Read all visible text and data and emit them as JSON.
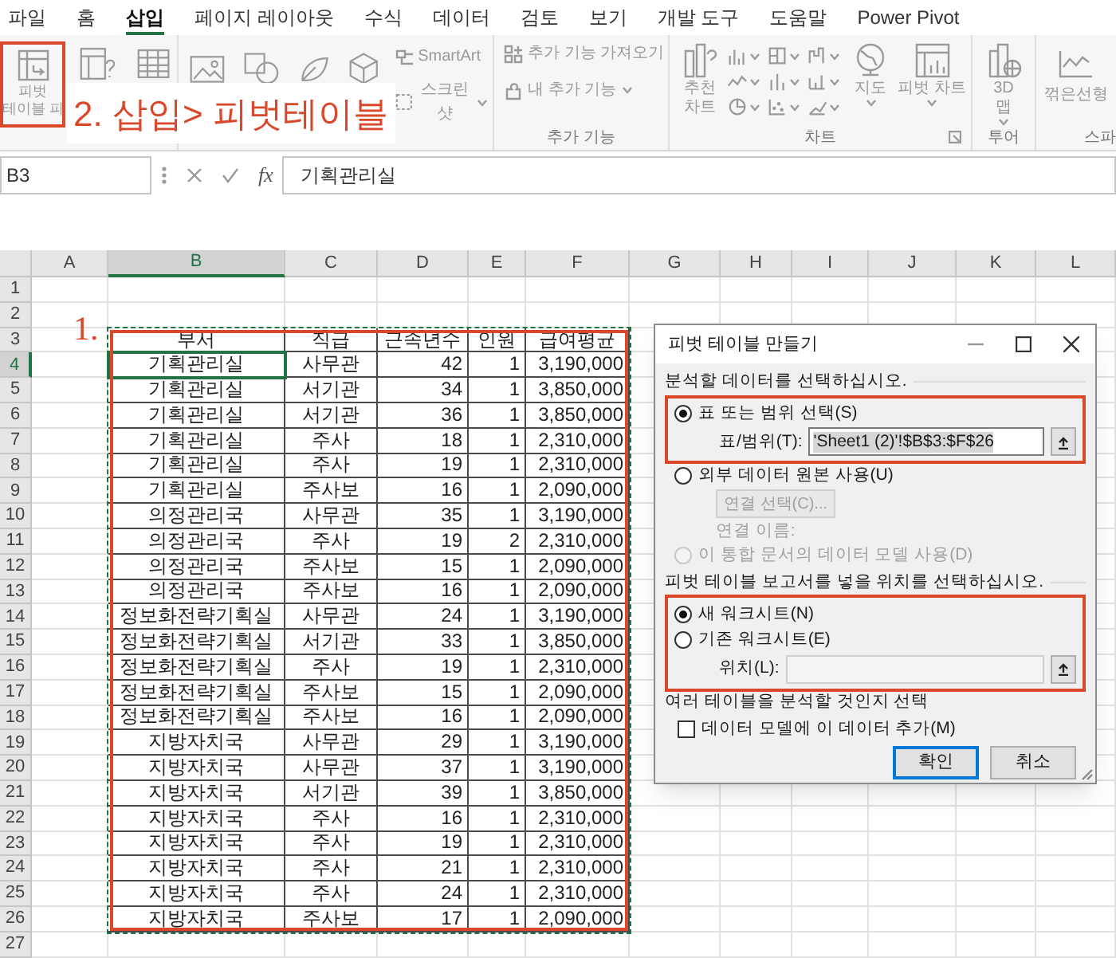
{
  "tabs": [
    {
      "label": "파일",
      "selected": false
    },
    {
      "label": "홈",
      "selected": false
    },
    {
      "label": "삽입",
      "selected": true
    },
    {
      "label": "페이지 레이아웃",
      "selected": false
    },
    {
      "label": "수식",
      "selected": false
    },
    {
      "label": "데이터",
      "selected": false
    },
    {
      "label": "검토",
      "selected": false
    },
    {
      "label": "보기",
      "selected": false
    },
    {
      "label": "개발 도구",
      "selected": false
    },
    {
      "label": "도움말",
      "selected": false
    },
    {
      "label": "Power Pivot",
      "selected": false
    }
  ],
  "ribbon": {
    "pivot_table": {
      "label_lines": [
        "피벗",
        "테이블 피"
      ],
      "highlighted": true
    },
    "smartart": "SmartArt",
    "screenshot": "스크린샷",
    "addins": {
      "items": [
        "추가 기능 가져오기",
        "내 추가 기능"
      ],
      "label": "추가 기능"
    },
    "charts": {
      "recommended": [
        "추천",
        "차트"
      ],
      "map": "지도",
      "pivot_chart": "피벗 차트",
      "label": "차트"
    },
    "tours": {
      "button": [
        "3D",
        "맵"
      ],
      "label": "투어"
    },
    "sparklines": {
      "button": "꺾은선형",
      "label": "스파"
    }
  },
  "annotations": [
    {
      "kind": "callout",
      "text": "2. 삽입> 피벗테이블"
    },
    {
      "kind": "marker",
      "text": "1."
    }
  ],
  "formula_bar": {
    "name_box": "B3",
    "fx": "fx",
    "formula": "기획관리실"
  },
  "sheet": {
    "range_marked": true,
    "columns": [
      {
        "label": "A",
        "selected": false
      },
      {
        "label": "B",
        "selected": true
      },
      {
        "label": "C",
        "selected": false
      },
      {
        "label": "D",
        "selected": false
      },
      {
        "label": "E",
        "selected": false
      },
      {
        "label": "F",
        "selected": false
      },
      {
        "label": "G",
        "selected": false
      },
      {
        "label": "H",
        "selected": false
      },
      {
        "label": "I",
        "selected": false
      },
      {
        "label": "J",
        "selected": false
      },
      {
        "label": "K",
        "selected": false
      },
      {
        "label": "L",
        "selected": false
      }
    ],
    "rows": [
      {
        "number": "1",
        "selected": false
      },
      {
        "number": "2",
        "selected": false
      },
      {
        "number": "3",
        "selected": false,
        "kind": "header",
        "cells": [
          "부서",
          "직급",
          "근속년수",
          "인원",
          "급여평균"
        ]
      },
      {
        "number": "4",
        "selected": true,
        "kind": "data",
        "cells": [
          "기획관리실",
          "사무관",
          "42",
          "1",
          "3,190,000"
        ]
      },
      {
        "number": "5",
        "selected": false,
        "kind": "data",
        "cells": [
          "기획관리실",
          "서기관",
          "34",
          "1",
          "3,850,000"
        ]
      },
      {
        "number": "6",
        "selected": false,
        "kind": "data",
        "cells": [
          "기획관리실",
          "서기관",
          "36",
          "1",
          "3,850,000"
        ]
      },
      {
        "number": "7",
        "selected": false,
        "kind": "data",
        "cells": [
          "기획관리실",
          "주사",
          "18",
          "1",
          "2,310,000"
        ]
      },
      {
        "number": "8",
        "selected": false,
        "kind": "data",
        "cells": [
          "기획관리실",
          "주사",
          "19",
          "1",
          "2,310,000"
        ]
      },
      {
        "number": "9",
        "selected": false,
        "kind": "data",
        "cells": [
          "기획관리실",
          "주사보",
          "16",
          "1",
          "2,090,000"
        ]
      },
      {
        "number": "10",
        "selected": false,
        "kind": "data",
        "cells": [
          "의정관리국",
          "사무관",
          "35",
          "1",
          "3,190,000"
        ]
      },
      {
        "number": "11",
        "selected": false,
        "kind": "data",
        "cells": [
          "의정관리국",
          "주사",
          "19",
          "2",
          "2,310,000"
        ]
      },
      {
        "number": "12",
        "selected": false,
        "kind": "data",
        "cells": [
          "의정관리국",
          "주사보",
          "15",
          "1",
          "2,090,000"
        ]
      },
      {
        "number": "13",
        "selected": false,
        "kind": "data",
        "cells": [
          "의정관리국",
          "주사보",
          "16",
          "1",
          "2,090,000"
        ]
      },
      {
        "number": "14",
        "selected": false,
        "kind": "data",
        "cells": [
          "정보화전략기획실",
          "사무관",
          "24",
          "1",
          "3,190,000"
        ]
      },
      {
        "number": "15",
        "selected": false,
        "kind": "data",
        "cells": [
          "정보화전략기획실",
          "서기관",
          "33",
          "1",
          "3,850,000"
        ]
      },
      {
        "number": "16",
        "selected": false,
        "kind": "data",
        "cells": [
          "정보화전략기획실",
          "주사",
          "19",
          "1",
          "2,310,000"
        ]
      },
      {
        "number": "17",
        "selected": false,
        "kind": "data",
        "cells": [
          "정보화전략기획실",
          "주사보",
          "15",
          "1",
          "2,090,000"
        ]
      },
      {
        "number": "18",
        "selected": false,
        "kind": "data",
        "cells": [
          "정보화전략기획실",
          "주사보",
          "16",
          "1",
          "2,090,000"
        ]
      },
      {
        "number": "19",
        "selected": false,
        "kind": "data",
        "cells": [
          "지방자치국",
          "사무관",
          "29",
          "1",
          "3,190,000"
        ]
      },
      {
        "number": "20",
        "selected": false,
        "kind": "data",
        "cells": [
          "지방자치국",
          "사무관",
          "37",
          "1",
          "3,190,000"
        ]
      },
      {
        "number": "21",
        "selected": false,
        "kind": "data",
        "cells": [
          "지방자치국",
          "서기관",
          "39",
          "1",
          "3,850,000"
        ]
      },
      {
        "number": "22",
        "selected": false,
        "kind": "data",
        "cells": [
          "지방자치국",
          "주사",
          "16",
          "1",
          "2,310,000"
        ]
      },
      {
        "number": "23",
        "selected": false,
        "kind": "data",
        "cells": [
          "지방자치국",
          "주사",
          "19",
          "1",
          "2,310,000"
        ]
      },
      {
        "number": "24",
        "selected": false,
        "kind": "data",
        "cells": [
          "지방자치국",
          "주사",
          "21",
          "1",
          "2,310,000"
        ]
      },
      {
        "number": "25",
        "selected": false,
        "kind": "data",
        "cells": [
          "지방자치국",
          "주사",
          "24",
          "1",
          "2,310,000"
        ]
      },
      {
        "number": "26",
        "selected": false,
        "kind": "data",
        "cells": [
          "지방자치국",
          "주사보",
          "17",
          "1",
          "2,090,000"
        ]
      },
      {
        "number": "27",
        "selected": false
      }
    ]
  },
  "dialog": {
    "title": "피벗 테이블 만들기",
    "source": {
      "heading": "분석할 데이터를 선택하십시오.",
      "highlighted": true,
      "options": [
        {
          "label": "표 또는 범위 선택(S)",
          "selected": true,
          "disabled": false
        },
        {
          "label": "외부 데이터 원본 사용(U)",
          "selected": false,
          "disabled": false
        },
        {
          "label": "이 통합 문서의 데이터 모델 사용(D)",
          "selected": false,
          "disabled": true
        }
      ],
      "range_label": "표/범위(T):",
      "range_value": "'Sheet1 (2)'!$B$3:$F$26",
      "connection_button": {
        "label": "연결 선택(C)...",
        "disabled": true
      },
      "connection_name_label": "연결 이름:"
    },
    "destination": {
      "heading": "피벗 테이블 보고서를 넣을 위치를 선택하십시오.",
      "highlighted": true,
      "options": [
        {
          "label": "새 워크시트(N)",
          "selected": true,
          "disabled": false
        },
        {
          "label": "기존 워크시트(E)",
          "selected": false,
          "disabled": false
        }
      ],
      "location_label": "위치(L):",
      "location_disabled": true
    },
    "multiple": {
      "heading": "여러 테이블을 분석할 것인지 선택",
      "checkbox": {
        "label": "데이터 모델에 이 데이터 추가(M)",
        "checked": false
      }
    },
    "buttons": [
      {
        "label": "확인",
        "default": true
      },
      {
        "label": "취소",
        "default": false
      }
    ]
  }
}
